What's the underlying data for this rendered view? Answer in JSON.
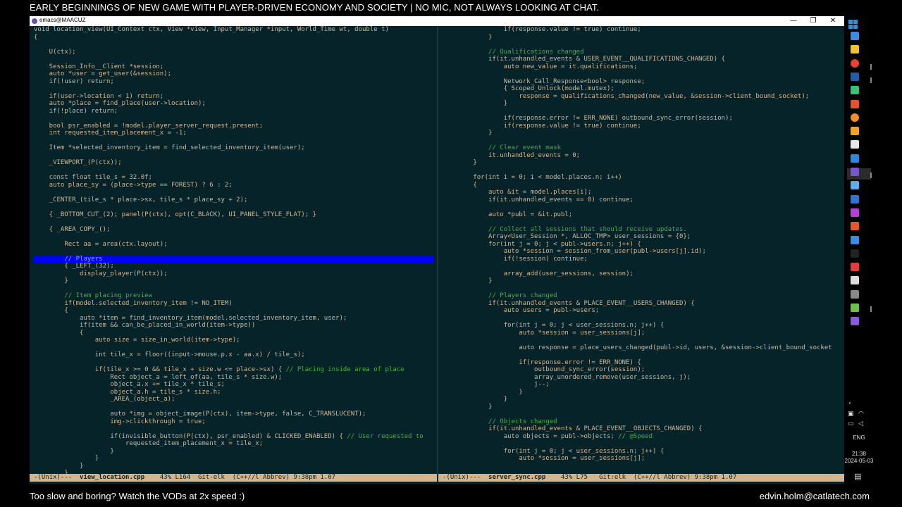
{
  "stream": {
    "title": "EARLY BEGINNINGS OF NEW GAME WITH PLAYER-DRIVEN ECONOMY AND SOCIETY | NO MIC, NOT ALWAYS LOOKING AT CHAT.",
    "bottom_left": "Too slow and boring? Watch the VODs at 2x speed :)",
    "bottom_right": "edvin.holm@catlatech.com"
  },
  "window": {
    "title": "emacs@MAACUZ",
    "minimize_glyph": "—",
    "maximize_glyph": "❐",
    "close_glyph": "✕"
  },
  "left_pane": {
    "modeline_prefix": "-(Unix)---  ",
    "filename": "view_location.cpp",
    "modeline_rest": "    43% L164  Git-elk  (C++//l Abbrev) 9:38pm 1.07",
    "lines": [
      "void location_view(UI_Context ctx, View *view, Input_Manager *input, World_Time wt, double t)",
      "{",
      "",
      "    U(ctx);",
      "",
      "    Session_Info__Client *session;",
      "    auto *user = get_user(&session);",
      "    if(!user) return;",
      "",
      "    if(user->location < 1) return;",
      "    auto *place = find_place(user->location);",
      "    if(!place) return;",
      "",
      "    bool psr_enabled = !model.player_server_request.present;",
      "    int requested_item_placement_x = -1;",
      "",
      "    Item *selected_inventory_item = find_selected_inventory_item(user);",
      "",
      "    _VIEWPORT_(P(ctx));",
      "",
      "    const float tile_s = 32.0f;",
      "    auto place_sy = (place->type == FOREST) ? 6 : 2;",
      "",
      "    _CENTER_(tile_s * place->sx, tile_s * place_sy + 2);",
      "",
      "    { _BOTTOM_CUT_(2); panel(P(ctx), opt(C_BLACK), UI_PANEL_STYLE_FLAT); }",
      "",
      "    { _AREA_COPY_();",
      "",
      "        Rect aa = area(ctx.layout);",
      "",
      "        // Players",
      "        { _LEFT_(32);",
      "            display_player(P(ctx));",
      "        }",
      "",
      "        // Item placing preview",
      "        if(model.selected_inventory_item != NO_ITEM)",
      "        {",
      "            auto *item = find_inventory_item(model.selected_inventory_item, user);",
      "            if(item && can_be_placed_in_world(item->type))",
      "            {",
      "                auto size = size_in_world(item->type);",
      "",
      "                int tile_x = floor((input->mouse.p.x - aa.x) / tile_s);",
      "",
      "                if(tile_x >= 0 && tile_x + size.w <= place->sx) { // Placing inside area of place",
      "                    Rect object_a = left_of(aa, tile_s * size.w);",
      "                    object_a.x += tile_x * tile_s;",
      "                    object_a.h = tile_s * size.h;",
      "                    _AREA_(object_a);",
      "",
      "                    auto *img = object_image(P(ctx), item->type, false, C_TRANSLUCENT);",
      "                    img->clickthrough = true;",
      "",
      "                    if(invisible_button(P(ctx), psr_enabled) & CLICKED_ENABLED) { // User requested to",
      "                        requested_item_placement_x = tile_x;",
      "                    }",
      "                }",
      "            }",
      "        }"
    ]
  },
  "right_pane": {
    "modeline_prefix": "-(Unix)---  ",
    "filename": "server_sync.cpp",
    "modeline_rest": "    43% L75   Git:elk  (C++//l Abbrev) 9:38pm 1.07",
    "lines": [
      "                if(response.value != true) continue;",
      "            }",
      "",
      "            // Qualifications changed",
      "            if(it.unhandled_events & USER_EVENT__QUALIFICATIONS_CHANGED) {",
      "                auto new_value = it.qualifications;",
      "",
      "                Network_Call_Response<bool> response;",
      "                { Scoped_Unlock(model.mutex);",
      "                    response = qualifications_changed(new_value, &session->client_bound_socket);",
      "                }",
      "",
      "                if(response.error != ERR_NONE) outbound_sync_error(session);",
      "                if(response.value != true) continue;",
      "            }",
      "",
      "            // Clear event mask",
      "            it.unhandled_events = 0;",
      "        }",
      "",
      "        for(int i = 0; i < model.places.n; i++)",
      "        {",
      "            auto &it = model.places[i];",
      "            if(it.unhandled_events == 0) continue;",
      "",
      "            auto *publ = &it.publ;",
      "",
      "            // Collect all sessions that should receive updates.",
      "            Array<User_Session *, ALLOC_TMP> user_sessions = {0};",
      "            for(int j = 0; j < publ->users.n; j++) {",
      "                auto *session = session_from_user(publ->users[j].id);",
      "                if(!session) continue;",
      "",
      "                array_add(user_sessions, session);",
      "            }",
      "",
      "            // Players changed",
      "            if(it.unhandled_events & PLACE_EVENT__USERS_CHANGED) {",
      "                auto users = publ->users;",
      "",
      "                for(int j = 0; j < user_sessions.n; j++) {",
      "                    auto *session = user_sessions[j];",
      "",
      "                    auto response = place_users_changed(publ->id, users, &session->client_bound_socket",
      "",
      "                    if(response.error != ERR_NONE) {",
      "                        outbound_sync_error(session);",
      "                        array_unordered_remove(user_sessions, j);",
      "                        j--;",
      "                    }",
      "                }",
      "            }",
      "",
      "            // Objects changed",
      "            if(it.unhandled_events & PLACE_EVENT__OBJECTS_CHANGED) {",
      "                auto objects = publ->objects; // @Speed",
      "",
      "                for(int j = 0; j < user_sessions.n; j++) {",
      "                    auto *session = user_sessions[j];",
      "",
      "                    "
    ]
  },
  "tray": {
    "language": "ENG",
    "time": "21:38",
    "date": "2024-05-03"
  },
  "colors": {
    "background": "#062329",
    "text": "#d1b897",
    "comment": "#44b340",
    "modeline": "#d3b58d",
    "highlight": "#0000ff"
  },
  "taskbar_icons": [
    "windows-start-icon",
    "search-icon",
    "file-explorer-icon",
    "chrome-icon",
    "terminal-icon",
    "app-icon",
    "app-icon",
    "firefox-icon",
    "app-icon",
    "app-icon",
    "app-icon",
    "emacs-icon",
    "app-icon",
    "app-icon",
    "app-icon",
    "app-icon",
    "app-icon",
    "app-icon",
    "app-icon",
    "app-icon",
    "app-icon",
    "app-icon",
    "visual-studio-icon"
  ]
}
